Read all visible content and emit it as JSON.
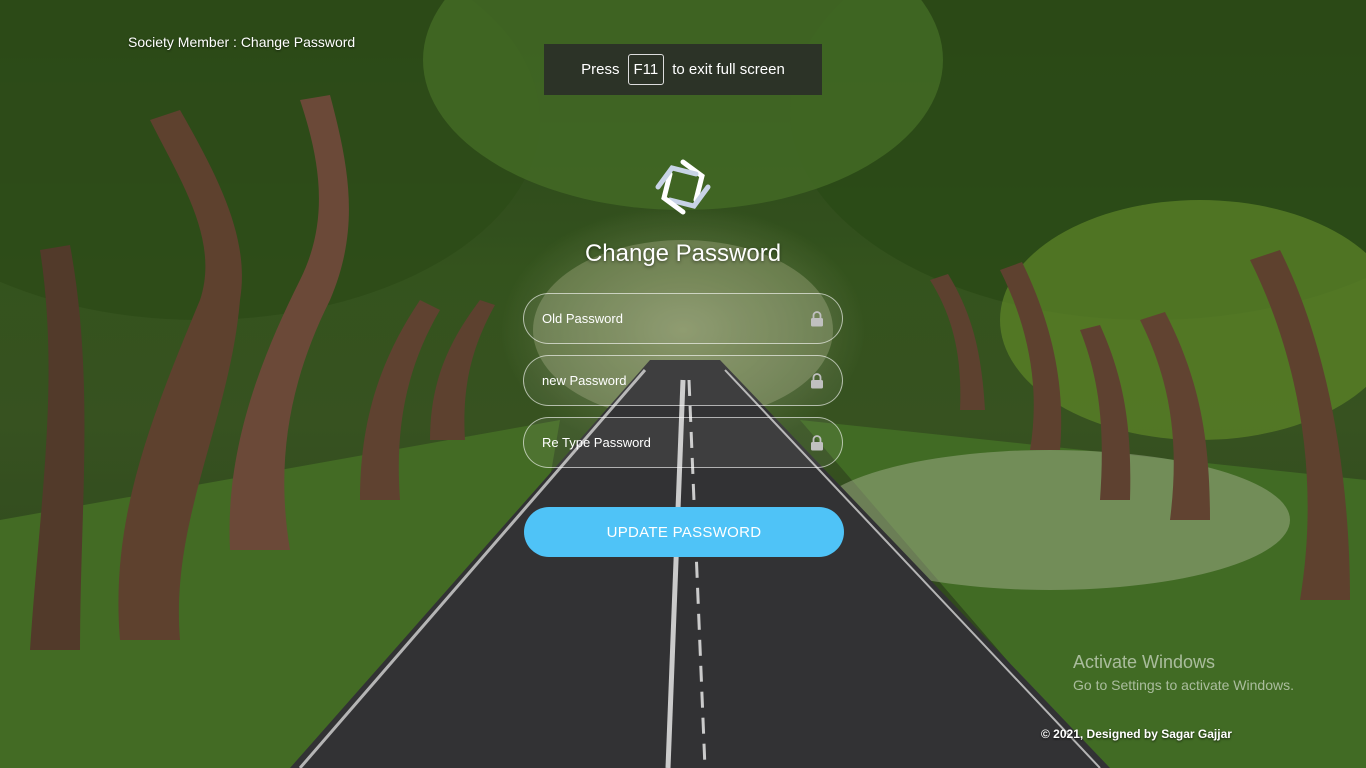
{
  "header": {
    "title": "Society Member : Change Password"
  },
  "fullscreen_notice": {
    "before": "Press",
    "key": "F11",
    "after": "to exit full screen"
  },
  "form": {
    "title": "Change Password",
    "fields": [
      {
        "placeholder": "Old Password",
        "icon": "lock-icon"
      },
      {
        "placeholder": "new Password",
        "icon": "lock-icon"
      },
      {
        "placeholder": "Re Type Password",
        "icon": "lock-icon"
      }
    ],
    "submit_label": "UPDATE PASSWORD"
  },
  "watermark": {
    "line1": "Activate Windows",
    "line2": "Go to Settings to activate Windows."
  },
  "footer": {
    "text": "© 2021, Designed by Sagar Gajjar"
  },
  "colors": {
    "accent": "#4fc3f7",
    "text": "#ffffff"
  }
}
